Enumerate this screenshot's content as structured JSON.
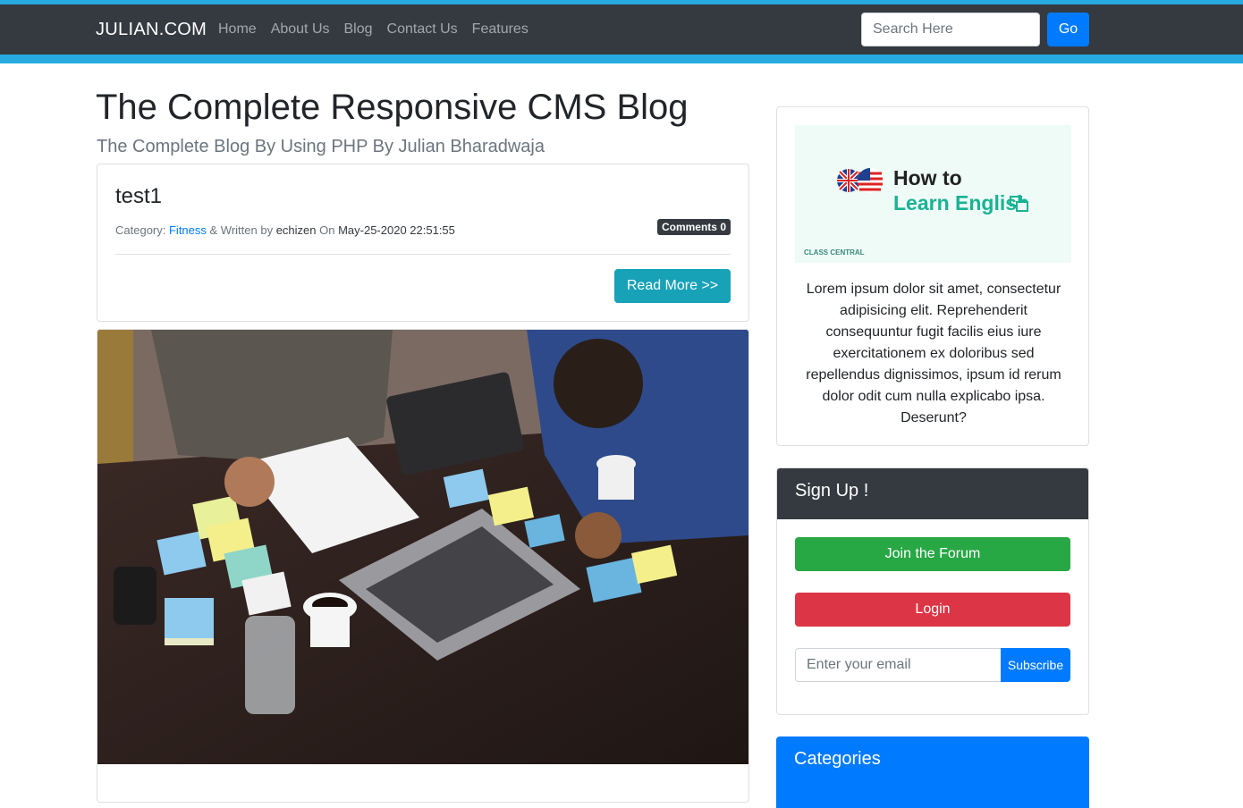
{
  "header": {
    "brand": "JULIAN.COM",
    "nav": [
      "Home",
      "About Us",
      "Blog",
      "Contact Us",
      "Features"
    ],
    "search_placeholder": "Search Here",
    "go_label": "Go"
  },
  "main": {
    "title": "The Complete Responsive CMS Blog",
    "subtitle": "The Complete Blog By Using PHP By Julian Bharadwaja",
    "post": {
      "title": "test1",
      "category_label": "Category: ",
      "category": "Fitness",
      "written_by_label": " & Written by ",
      "author": "echizen",
      "on_label": " On ",
      "date": "May-25-2020 22:51:55",
      "comments_label": "Comments",
      "comments_count": "0",
      "read_more": "Read More >>"
    }
  },
  "sidebar": {
    "ad": {
      "line1": "How to",
      "line2": "Learn English",
      "footer": "CLASS CENTRAL"
    },
    "text": "Lorem ipsum dolor sit amet, consectetur adipisicing elit. Reprehenderit consequuntur fugit facilis eius iure exercitationem ex doloribus sed repellendus dignissimos, ipsum id rerum dolor odit cum nulla explicabo ipsa. Deserunt?",
    "signup": {
      "title": "Sign Up !",
      "join": "Join the Forum",
      "login": "Login",
      "email_placeholder": "Enter your email",
      "subscribe": "Subscribe"
    },
    "categories_title": "Categories"
  },
  "colors": {
    "navbar": "#343a40",
    "accent_border": "#27aae1",
    "primary": "#007bff",
    "info": "#17a2b8",
    "success": "#28a745",
    "danger": "#dc3545"
  }
}
